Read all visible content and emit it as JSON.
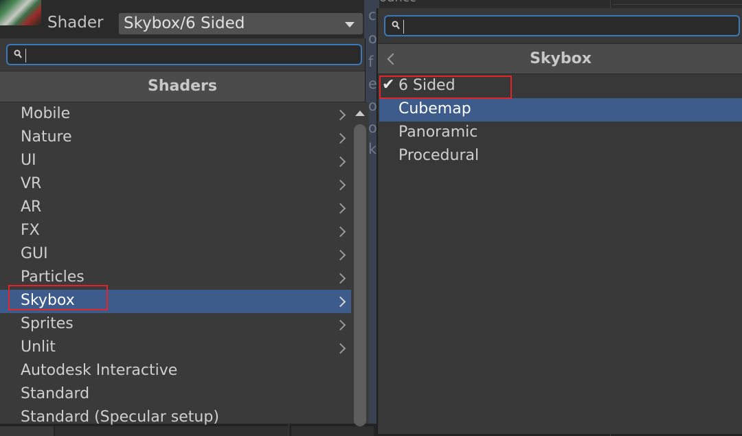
{
  "material": {
    "shader_label": "Shader",
    "shader_value": "Skybox/6 Sided"
  },
  "left_popup": {
    "search": {
      "value": ""
    },
    "header": "Shaders",
    "items": [
      {
        "label": "Mobile",
        "has_submenu": true
      },
      {
        "label": "Nature",
        "has_submenu": true
      },
      {
        "label": "UI",
        "has_submenu": true
      },
      {
        "label": "VR",
        "has_submenu": true
      },
      {
        "label": "AR",
        "has_submenu": true
      },
      {
        "label": "FX",
        "has_submenu": true
      },
      {
        "label": "GUI",
        "has_submenu": true
      },
      {
        "label": "Particles",
        "has_submenu": true
      },
      {
        "label": "Skybox",
        "has_submenu": true,
        "selected": true
      },
      {
        "label": "Sprites",
        "has_submenu": true
      },
      {
        "label": "Unlit",
        "has_submenu": true
      },
      {
        "label": "Autodesk Interactive",
        "has_submenu": false
      },
      {
        "label": "Standard",
        "has_submenu": false
      },
      {
        "label": "Standard (Specular setup)",
        "has_submenu": false
      }
    ]
  },
  "right_popup": {
    "search": {
      "value": ""
    },
    "header": "Skybox",
    "items": [
      {
        "label": "6 Sided",
        "checked": true,
        "check_glyph": "✔"
      },
      {
        "label": "Cubemap",
        "selected": true
      },
      {
        "label": "Panoramic"
      },
      {
        "label": "Procedural"
      }
    ]
  },
  "colors": {
    "selection": "#3d5b8b",
    "focus_outline": "#3a79bb",
    "annotation_box": "#e3242b"
  },
  "icons": {
    "search": "magnifier-icon",
    "submenu": "chevron-right-icon",
    "back": "chevron-left-icon",
    "dropdown": "triangle-down-icon",
    "check": "checkmark-icon"
  }
}
